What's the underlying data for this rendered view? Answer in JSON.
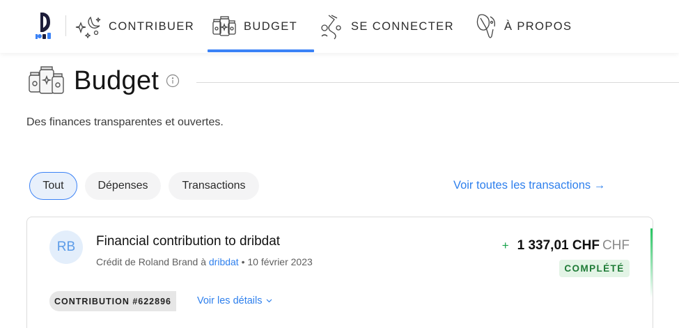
{
  "nav": {
    "items": [
      {
        "label": "CONTRIBUER",
        "icon": "stars-moon-icon"
      },
      {
        "label": "BUDGET",
        "icon": "jars-icon",
        "active": true
      },
      {
        "label": "SE CONNECTER",
        "icon": "tube-icon"
      },
      {
        "label": "À PROPOS",
        "icon": "leaf-hand-icon"
      }
    ],
    "active_color": "#3b82f6"
  },
  "page": {
    "title": "Budget",
    "subtitle": "Des finances transparentes et ouvertes."
  },
  "tabs": [
    {
      "label": "Tout",
      "active": true
    },
    {
      "label": "Dépenses",
      "active": false
    },
    {
      "label": "Transactions",
      "active": false
    }
  ],
  "all_transactions_link": "Voir toutes les transactions →",
  "transaction": {
    "avatar_initials": "RB",
    "title": "Financial contribution to dribdat",
    "meta_prefix": "Crédit de Roland Brand à",
    "meta_link": "dribdat",
    "meta_sep": "•",
    "meta_date": "10 février 2023",
    "amount_sign": "+",
    "amount_value": "1 337,01 CHF",
    "amount_currency": "CHF",
    "status": "COMPLÉTÉ",
    "contribution_tag": "CONTRIBUTION #622896",
    "details_link": "Voir les détails"
  }
}
